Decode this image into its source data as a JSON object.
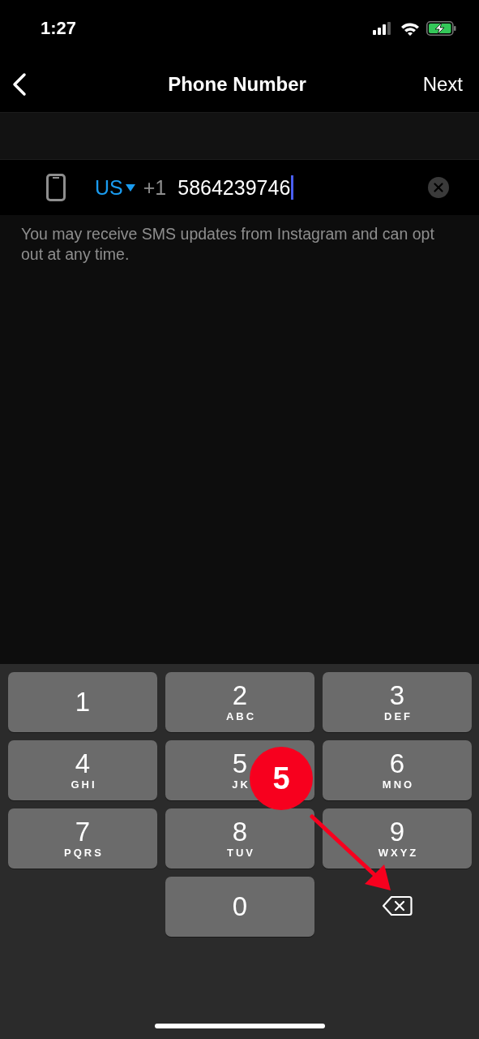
{
  "status_bar": {
    "time": "1:27"
  },
  "nav": {
    "title": "Phone Number",
    "action": "Next"
  },
  "phone_field": {
    "country": "US",
    "dial_code": "+1",
    "value": "5864239746"
  },
  "notice": "You may receive SMS updates from Instagram and can opt out at any time.",
  "keypad": [
    {
      "kind": "digit",
      "digit": "1"
    },
    {
      "kind": "digit",
      "digit": "2",
      "letters": "ABC"
    },
    {
      "kind": "digit",
      "digit": "3",
      "letters": "DEF"
    },
    {
      "kind": "digit",
      "digit": "4",
      "letters": "GHI"
    },
    {
      "kind": "digit",
      "digit": "5",
      "letters": "JK"
    },
    {
      "kind": "digit",
      "digit": "6",
      "letters": "MNO"
    },
    {
      "kind": "digit",
      "digit": "7",
      "letters": "PQRS"
    },
    {
      "kind": "digit",
      "digit": "8",
      "letters": "TUV"
    },
    {
      "kind": "digit",
      "digit": "9",
      "letters": "WXYZ"
    },
    {
      "kind": "empty"
    },
    {
      "kind": "digit",
      "digit": "0"
    },
    {
      "kind": "backspace"
    }
  ],
  "annotation": {
    "step": "5"
  }
}
